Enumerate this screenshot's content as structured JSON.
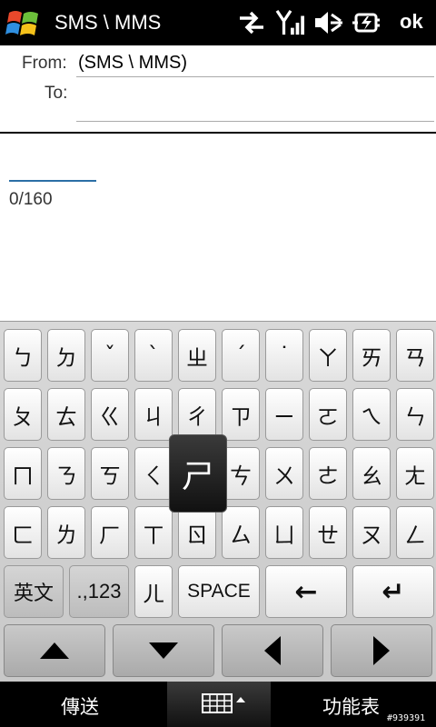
{
  "titlebar": {
    "title": "SMS \\ MMS",
    "ok_label": "ok"
  },
  "header": {
    "from_label": "From:",
    "from_value": "(SMS \\ MMS)",
    "to_label": "To:",
    "to_value": ""
  },
  "message": {
    "counter": "0/160"
  },
  "keyboard": {
    "row1": [
      "ㄅ",
      "ㄉ",
      "ˇ",
      "ˋ",
      "ㄓ",
      "ˊ",
      "˙",
      "ㄚ",
      "ㄞ",
      "ㄢ"
    ],
    "row2": [
      "ㄆ",
      "ㄊ",
      "ㄍ",
      "ㄐ",
      "ㄔ",
      "ㄗ",
      "ㄧ",
      "ㄛ",
      "ㄟ",
      "ㄣ"
    ],
    "row3": [
      "ㄇ",
      "ㄋ",
      "ㄎ",
      "ㄑ",
      "ㄕ",
      "ㄘ",
      "ㄨ",
      "ㄜ",
      "ㄠ",
      "ㄤ"
    ],
    "row4": [
      "ㄈ",
      "ㄌ",
      "ㄏ",
      "ㄒ",
      "ㄖ",
      "ㄙ",
      "ㄩ",
      "ㄝ",
      "ㄡ",
      "ㄥ"
    ],
    "popup": "ㄕ",
    "lang_label": "英文",
    "num_label": ".,123",
    "er_label": "ㄦ",
    "space_label": "SPACE",
    "backspace_label": "←",
    "enter_label": "↵"
  },
  "bottombar": {
    "left_softkey": "傳送",
    "right_softkey": "功能表"
  },
  "watermark": "#939391"
}
